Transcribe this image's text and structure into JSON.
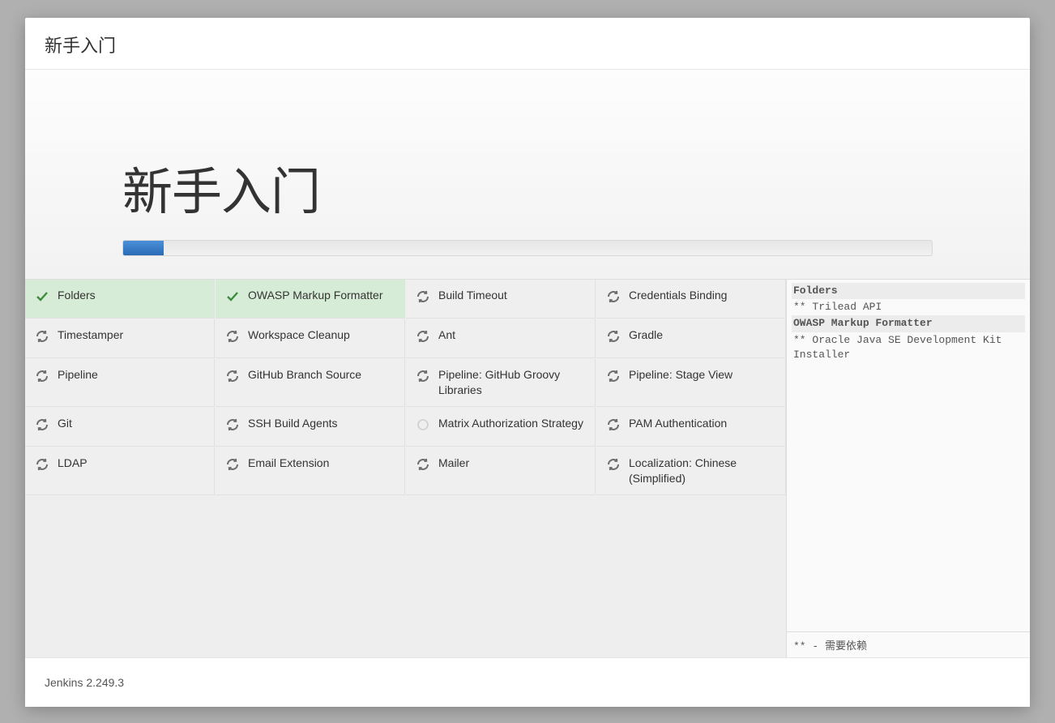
{
  "window": {
    "title": "新手入门"
  },
  "hero": {
    "title": "新手入门",
    "progress_percent": 5
  },
  "plugins": [
    {
      "label": "Folders",
      "state": "done"
    },
    {
      "label": "OWASP Markup Formatter",
      "state": "done"
    },
    {
      "label": "Build Timeout",
      "state": "pending"
    },
    {
      "label": "Credentials Binding",
      "state": "pending"
    },
    {
      "label": "Timestamper",
      "state": "pending"
    },
    {
      "label": "Workspace Cleanup",
      "state": "pending"
    },
    {
      "label": "Ant",
      "state": "pending"
    },
    {
      "label": "Gradle",
      "state": "pending"
    },
    {
      "label": "Pipeline",
      "state": "pending"
    },
    {
      "label": "GitHub Branch Source",
      "state": "pending"
    },
    {
      "label": "Pipeline: GitHub Groovy Libraries",
      "state": "pending"
    },
    {
      "label": "Pipeline: Stage View",
      "state": "pending"
    },
    {
      "label": "Git",
      "state": "pending"
    },
    {
      "label": "SSH Build Agents",
      "state": "pending"
    },
    {
      "label": "Matrix Authorization Strategy",
      "state": "blank"
    },
    {
      "label": "PAM Authentication",
      "state": "pending"
    },
    {
      "label": "LDAP",
      "state": "pending"
    },
    {
      "label": "Email Extension",
      "state": "pending"
    },
    {
      "label": "Mailer",
      "state": "pending"
    },
    {
      "label": "Localization: Chinese (Simplified)",
      "state": "pending"
    }
  ],
  "log": {
    "lines": [
      {
        "text": "Folders",
        "bold": true
      },
      {
        "text": "** Trilead API",
        "bold": false
      },
      {
        "text": "OWASP Markup Formatter",
        "bold": true
      },
      {
        "text": "** Oracle Java SE Development Kit Installer",
        "bold": false
      }
    ],
    "legend": "** - 需要依赖"
  },
  "footer": {
    "version": "Jenkins 2.249.3"
  }
}
